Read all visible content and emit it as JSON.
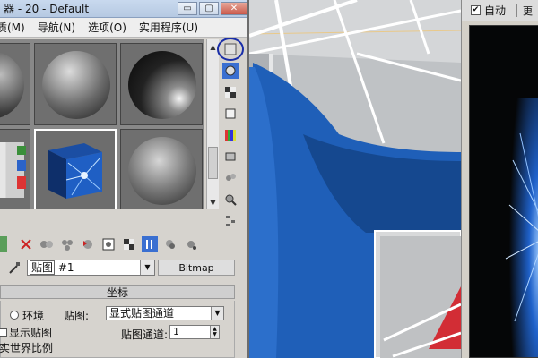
{
  "window": {
    "title": "器 - 20 - Default",
    "buttons": {
      "minimize": "▭",
      "maximize": "▢",
      "close": "✕"
    }
  },
  "menubar": {
    "items": [
      "质(M)",
      "导航(N)",
      "选项(O)",
      "实用程序(U)"
    ]
  },
  "map": {
    "name_label": "贴图",
    "name_value": "#1",
    "type_button": "Bitmap"
  },
  "rollout": {
    "title": "坐标",
    "environment_label": "环境",
    "map_label": "贴图:",
    "mapping_value": "显式贴图通道",
    "channel_label": "贴图通道:",
    "channel_value": "1",
    "show_map_label": "显示贴图",
    "real_world_label": "实世界比例"
  },
  "right_panel": {
    "auto_label": "自动",
    "auto_checked": true,
    "extra_label": "更"
  },
  "icons": {
    "side_tools": [
      "sample-type-icon",
      "backlight-icon",
      "background-icon",
      "sample-uv-tiling-icon",
      "video-color-check-icon",
      "make-preview-icon",
      "options-icon",
      "select-by-material-icon",
      "material-map-navigator-icon"
    ],
    "toolbar": [
      "close-icon",
      "put-to-scene-icon",
      "assign-material-icon",
      "reset-map-icon",
      "copy-material-icon",
      "make-unique-icon",
      "show-map-in-viewport-icon",
      "show-end-result-icon",
      "go-to-parent-icon",
      "go-forward-icon"
    ],
    "eyedropper": "eyedropper-icon"
  },
  "colors": {
    "accent_blue": "#1f5fb8",
    "annotation_circle": "#1a2ea8",
    "close_red": "#c9584a"
  }
}
